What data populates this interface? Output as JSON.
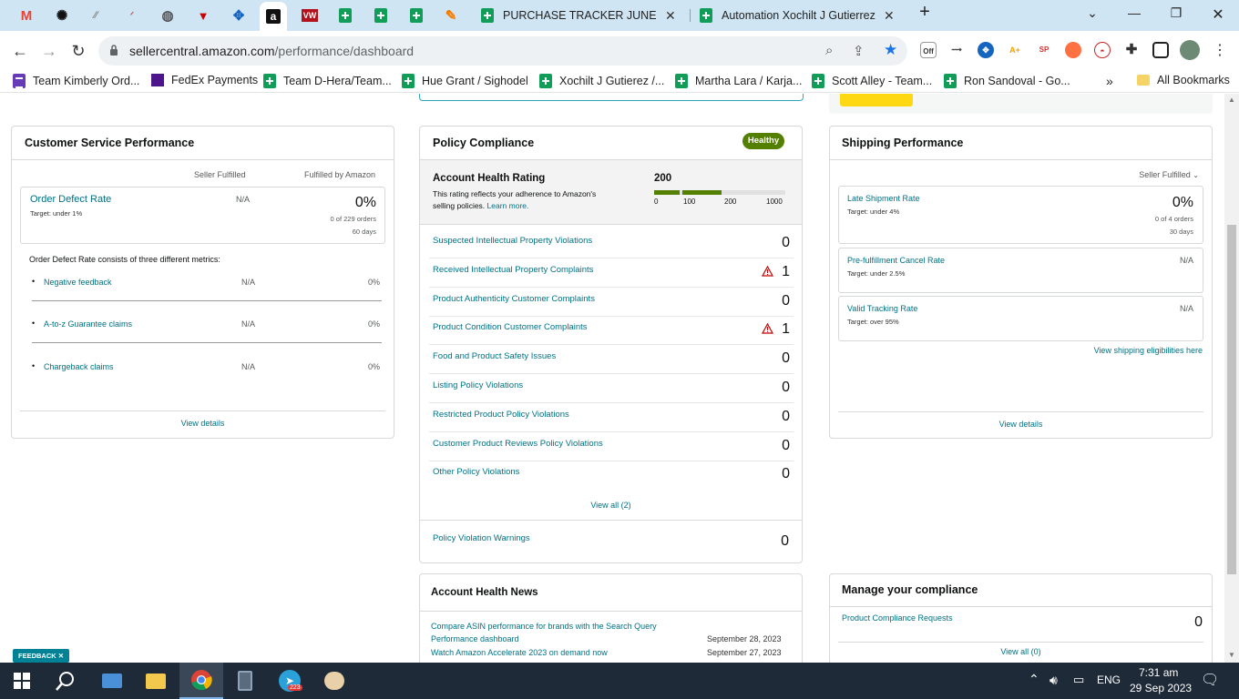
{
  "browser": {
    "tabs": [
      {
        "title": "PURCHASE TRACKER JUNE - Goo"
      },
      {
        "title": "Automation Xochilt J Gutierrez ("
      }
    ],
    "url_host": "sellercentral.amazon.com",
    "url_path": "/performance/dashboard",
    "bookmarks": [
      "Team Kimberly Ord...",
      "FedEx Payments",
      "Team D-Hera/Team...",
      "Hue Grant / Sighodel",
      "Xochilt J Gutierez /...",
      "Martha Lara / Karja...",
      "Scott Alley - Team...",
      "Ron Sandoval - Go...",
      "All Bookmarks"
    ],
    "ext_off_badge": "Off"
  },
  "customer_service": {
    "title": "Customer Service Performance",
    "col_seller": "Seller Fulfilled",
    "col_fba": "Fulfilled by Amazon",
    "odr_label": "Order Defect Rate",
    "odr_target": "Target: under 1%",
    "odr_seller": "N/A",
    "odr_fba": "0%",
    "odr_orders": "0 of 229 orders",
    "odr_days": "60 days",
    "consists": "Order Defect Rate consists of three different metrics:",
    "metrics": [
      {
        "label": "Negative feedback",
        "seller": "N/A",
        "fba": "0%"
      },
      {
        "label": "A-to-z Guarantee claims",
        "seller": "N/A",
        "fba": "0%"
      },
      {
        "label": "Chargeback claims",
        "seller": "N/A",
        "fba": "0%"
      }
    ],
    "view_details": "View details"
  },
  "policy": {
    "title": "Policy Compliance",
    "status": "Healthy",
    "ahr_title": "Account Health Rating",
    "ahr_desc1": "This rating reflects your adherence to Amazon's",
    "ahr_desc2": "selling policies.",
    "learn_more": "Learn more.",
    "ahr_value": "200",
    "ahr_score": 200,
    "ahr_scale": [
      "0",
      "100",
      "200",
      "1000"
    ],
    "rows": [
      {
        "label": "Suspected Intellectual Property Violations",
        "value": "0",
        "warn": false
      },
      {
        "label": "Received Intellectual Property Complaints",
        "value": "1",
        "warn": true
      },
      {
        "label": "Product Authenticity Customer Complaints",
        "value": "0",
        "warn": false
      },
      {
        "label": "Product Condition Customer Complaints",
        "value": "1",
        "warn": true
      },
      {
        "label": "Food and Product Safety Issues",
        "value": "0",
        "warn": false
      },
      {
        "label": "Listing Policy Violations",
        "value": "0",
        "warn": false
      },
      {
        "label": "Restricted Product Policy Violations",
        "value": "0",
        "warn": false
      },
      {
        "label": "Customer Product Reviews Policy Violations",
        "value": "0",
        "warn": false
      },
      {
        "label": "Other Policy Violations",
        "value": "0",
        "warn": false
      }
    ],
    "view_all": "View all (2)",
    "warnings_label": "Policy Violation Warnings",
    "warnings_value": "0"
  },
  "news": {
    "title": "Account Health News",
    "items": [
      {
        "text1": "Compare ASIN performance for brands with the Search Query",
        "text2": "Performance dashboard",
        "date": "September 28, 2023"
      },
      {
        "text1": "Watch Amazon Accelerate 2023 on demand now",
        "text2": "",
        "date": "September 27, 2023"
      }
    ]
  },
  "shipping": {
    "title": "Shipping Performance",
    "filter": "Seller Fulfilled",
    "late_label": "Late Shipment Rate",
    "late_target": "Target: under 4%",
    "late_value": "0%",
    "late_orders": "0 of 4 orders",
    "late_days": "30 days",
    "cancel_label": "Pre-fulfillment Cancel Rate",
    "cancel_target": "Target: under 2.5%",
    "cancel_value": "N/A",
    "tracking_label": "Valid Tracking Rate",
    "tracking_target": "Target: over 95%",
    "tracking_value": "N/A",
    "eligibilities": "View shipping eligibilities here",
    "view_details": "View details"
  },
  "compliance": {
    "title": "Manage your compliance",
    "req_label": "Product Compliance Requests",
    "req_value": "0",
    "view_all": "View all (0)"
  },
  "feedback": "FEEDBACK ✕",
  "taskbar": {
    "lang": "ENG",
    "time": "7:31 am",
    "date": "29 Sep 2023",
    "telegram_badge": "223"
  },
  "colors": {
    "link": "#007185",
    "healthy": "#538000",
    "tabstrip": "#cfe5f4",
    "taskbar": "#1e2a38"
  }
}
